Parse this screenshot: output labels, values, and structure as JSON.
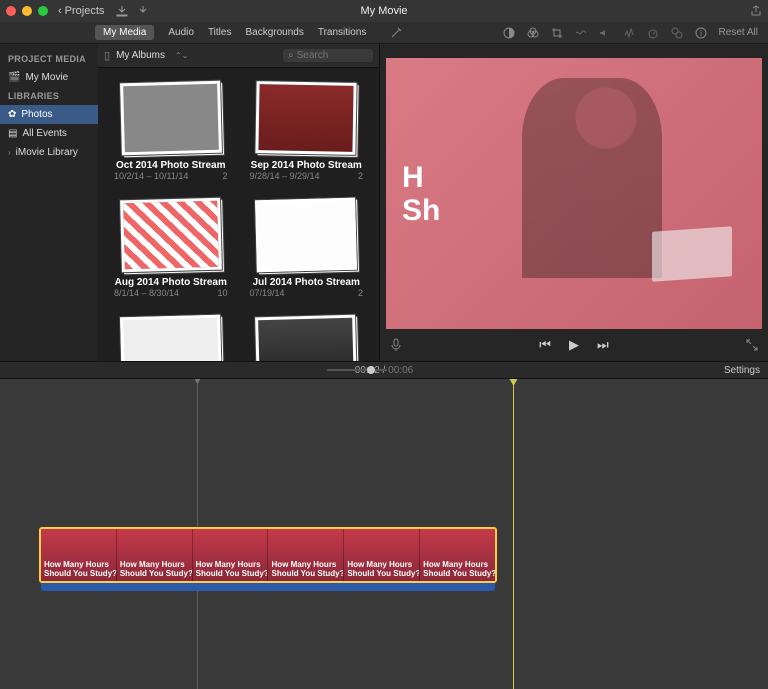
{
  "window": {
    "title": "My Movie",
    "back_label": "Projects"
  },
  "tabs": [
    "My Media",
    "Audio",
    "Titles",
    "Backgrounds",
    "Transitions"
  ],
  "right_toolbar": {
    "reset_label": "Reset All"
  },
  "sidebar": {
    "section1": "PROJECT MEDIA",
    "item1": "My Movie",
    "section2": "LIBRARIES",
    "item2": "Photos",
    "item3": "All Events",
    "item4": "iMovie Library"
  },
  "media": {
    "selector_label": "My Albums",
    "search_placeholder": "Search",
    "albums": [
      {
        "title": "Oct 2014 Photo Stream",
        "dates": "10/2/14 – 10/11/14",
        "count": "2"
      },
      {
        "title": "Sep 2014 Photo Stream",
        "dates": "9/28/14 – 9/29/14",
        "count": "2"
      },
      {
        "title": "Aug 2014 Photo Stream",
        "dates": "8/1/14 – 8/30/14",
        "count": "10"
      },
      {
        "title": "Jul 2014 Photo Stream",
        "dates": "07/19/14",
        "count": "2"
      },
      {
        "title": "",
        "dates": "",
        "count": ""
      },
      {
        "title": "",
        "dates": "",
        "count": ""
      }
    ]
  },
  "player": {
    "overlay_line1": "H",
    "overlay_line2": "Sh"
  },
  "timeline": {
    "current": "00:02",
    "total": "00:06",
    "sep": " / ",
    "settings_label": "Settings",
    "clip_line1": "How Many Hours",
    "clip_line2": "Should You Study?",
    "clip_alt_line1": "How Many Hours",
    "clip_alt_line2": "Should You Study?"
  }
}
